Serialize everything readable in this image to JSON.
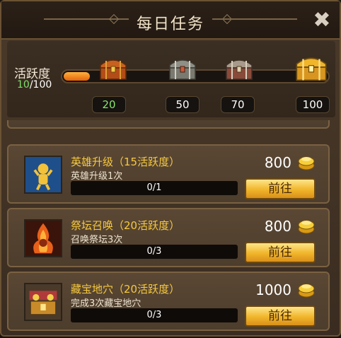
{
  "window": {
    "title": "每日任务",
    "close_icon": "close-icon"
  },
  "activity": {
    "label": "活跃度",
    "current": "10",
    "max": "/100",
    "progress_fraction": 0.1,
    "milestones": [
      "20",
      "50",
      "70",
      "100"
    ]
  },
  "tasks": [
    {
      "name": "英雄升级（15活跃度）",
      "desc": "英雄升级1次",
      "progress": "0/1",
      "reward": "800",
      "button": "前往",
      "icon": "hero-upgrade-icon"
    },
    {
      "name": "祭坛召唤（20活跃度）",
      "desc": "召唤祭坛3次",
      "progress": "0/3",
      "reward": "800",
      "button": "前往",
      "icon": "altar-summon-icon"
    },
    {
      "name": "藏宝地穴（20活跃度）",
      "desc": "完成3次藏宝地穴",
      "progress": "0/3",
      "reward": "1000",
      "button": "前往",
      "icon": "treasure-cave-icon"
    }
  ]
}
